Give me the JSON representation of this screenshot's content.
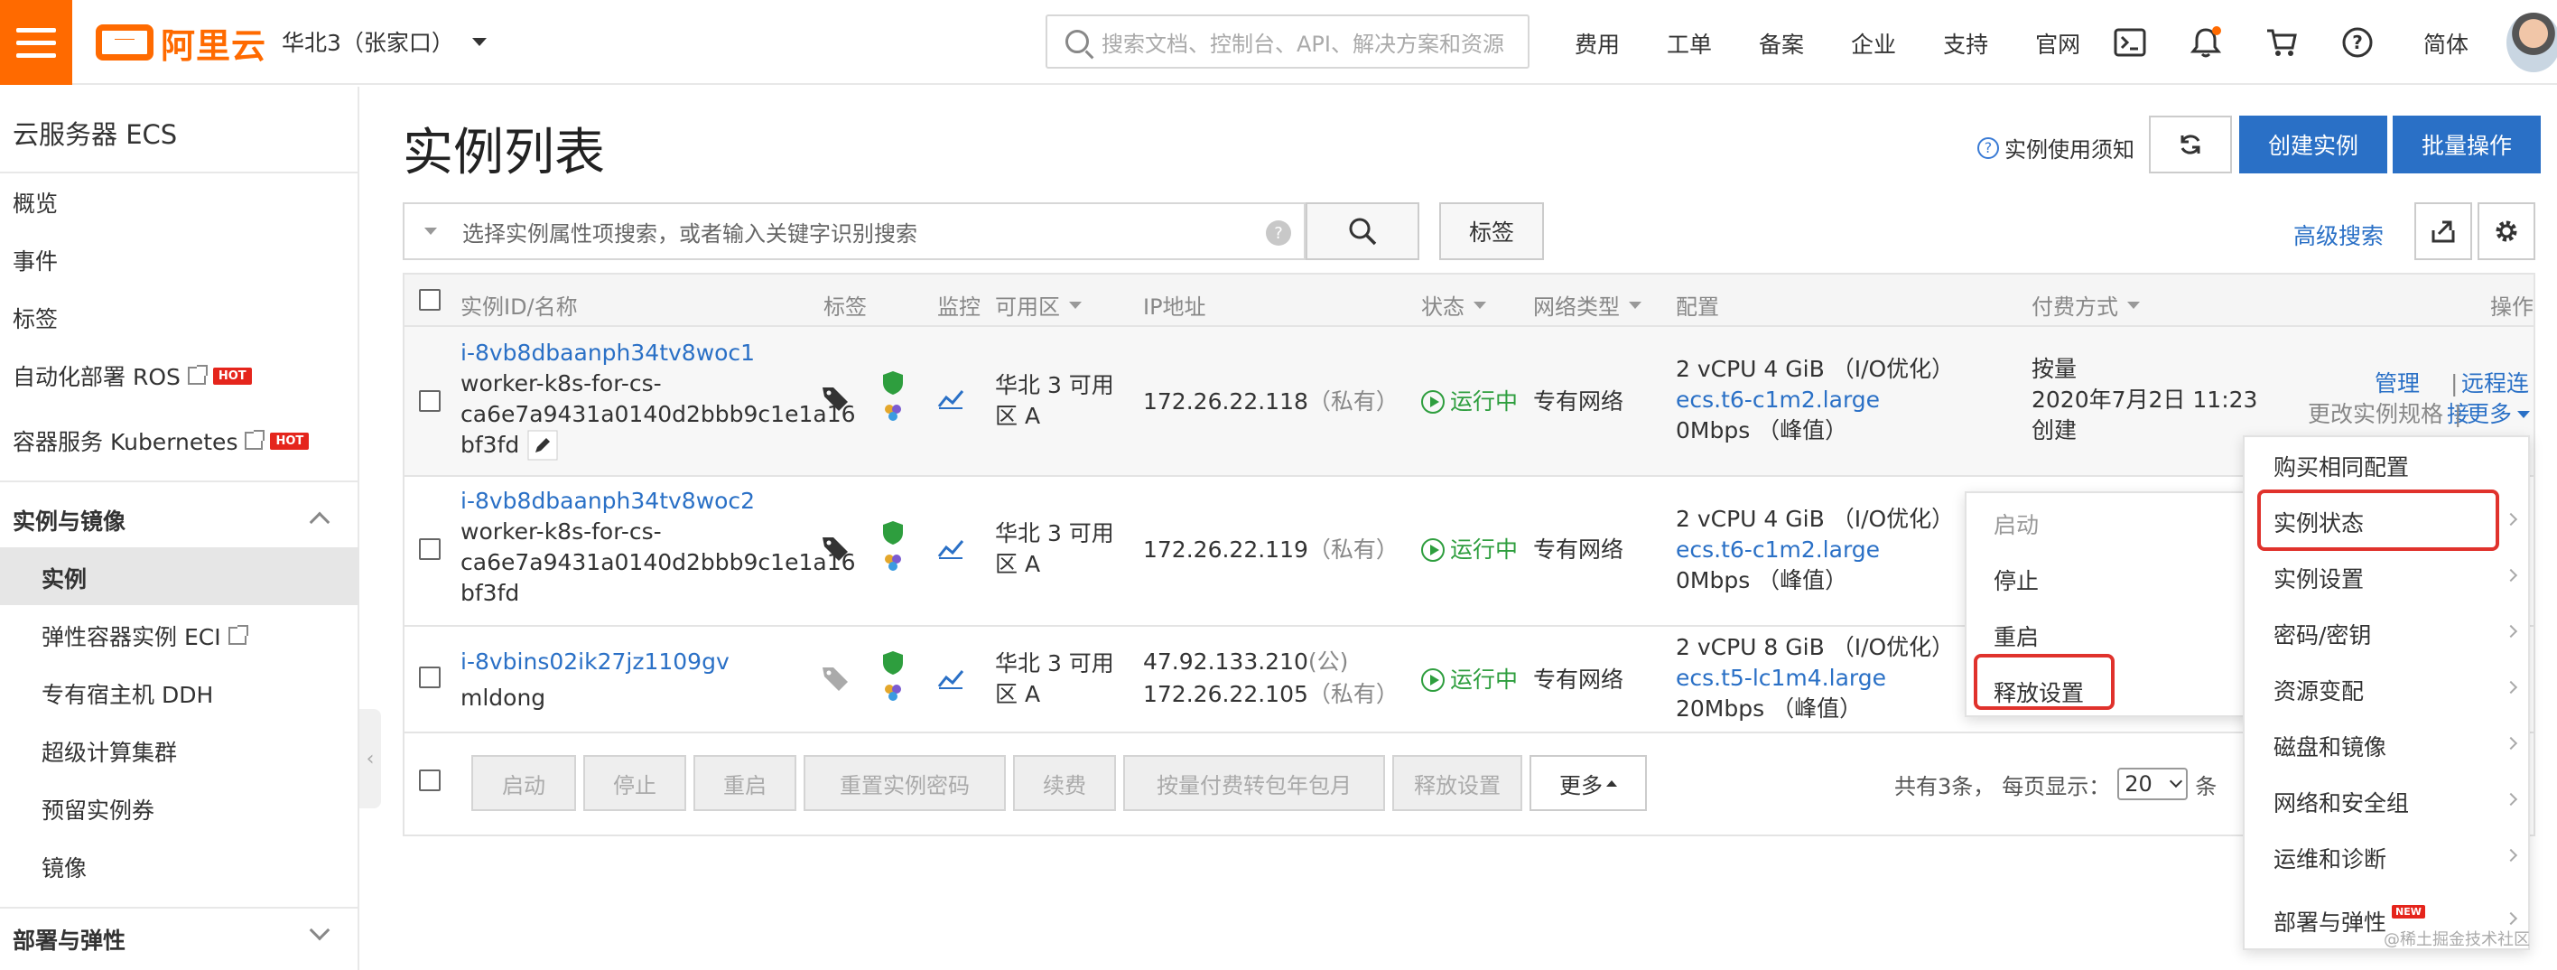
{
  "header": {
    "logo": "阿里云",
    "region": "华北3（张家口）",
    "search_placeholder": "搜索文档、控制台、API、解决方案和资源",
    "links": [
      "费用",
      "工单",
      "备案",
      "企业",
      "支持",
      "官网"
    ],
    "lang": "简体"
  },
  "sidebar": {
    "title": "云服务器 ECS",
    "items": [
      "概览",
      "事件",
      "标签",
      "自动化部署 ROS",
      "容器服务 Kubernetes"
    ],
    "hot": "HOT",
    "group1": "实例与镜像",
    "sub": [
      "实例",
      "弹性容器实例 ECI",
      "专有宿主机 DDH",
      "超级计算集群",
      "预留实例券",
      "镜像"
    ],
    "group2": "部署与弹性"
  },
  "main": {
    "title": "实例列表",
    "notice": "实例使用须知",
    "create": "创建实例",
    "batch": "批量操作",
    "filter_placeholder": "选择实例属性项搜索，或者输入关键字识别搜索",
    "tag_btn": "标签",
    "advanced": "高级搜索"
  },
  "table": {
    "headers": {
      "id": "实例ID/名称",
      "tag": "标签",
      "monitor": "监控",
      "zone": "可用区",
      "ip": "IP地址",
      "status": "状态",
      "net": "网络类型",
      "config": "配置",
      "pay": "付费方式",
      "ops": "操作"
    },
    "rows": [
      {
        "id": "i-8vb8dbaanph34tv8woc1",
        "name1": "worker-k8s-for-cs-",
        "name2": "ca6e7a9431a0140d2bbb9c1e1a16",
        "name3": "bf3fd",
        "zone1": "华北 3 可用",
        "zone2": "区 A",
        "ip1": "172.26.22.118",
        "ip1_note": "（私有）",
        "status": "运行中",
        "net": "专有网络",
        "cfg1": "2 vCPU 4 GiB （I/O优化）",
        "cfg2": "ecs.t6-c1m2.large",
        "cfg3": "0Mbps （峰值）",
        "pay1": "按量",
        "pay2": "2020年7月2日 11:23",
        "pay3": "创建",
        "op_manage": "管理",
        "op_remote": "远程连接",
        "op_change": "更改实例规格",
        "op_more": "更多"
      },
      {
        "id": "i-8vb8dbaanph34tv8woc2",
        "name1": "worker-k8s-for-cs-",
        "name2": "ca6e7a9431a0140d2bbb9c1e1a16",
        "name3": "bf3fd",
        "zone1": "华北 3 可用",
        "zone2": "区 A",
        "ip1": "172.26.22.119",
        "ip1_note": "（私有）",
        "status": "运行中",
        "net": "专有网络",
        "cfg1": "2 vCPU 4 GiB （I/O优化）",
        "cfg2": "ecs.t6-c1m2.large",
        "cfg3": "0Mbps （峰值）"
      },
      {
        "id": "i-8vbins02ik27jz1109gv",
        "name1": "mldong",
        "zone1": "华北 3 可用",
        "zone2": "区 A",
        "ip1": "47.92.133.210",
        "ip1_note": "(公)",
        "ip2": "172.26.22.105",
        "ip2_note": "（私有）",
        "status": "运行中",
        "net": "专有网络",
        "cfg1": "2 vCPU 8 GiB （I/O优化）",
        "cfg2": "ecs.t5-lc1m4.large",
        "cfg3": "20Mbps （峰值）"
      }
    ]
  },
  "footer": {
    "buttons": [
      "启动",
      "停止",
      "重启",
      "重置实例密码",
      "续费",
      "按量付费转包年包月",
      "释放设置"
    ],
    "more": "更多",
    "total": "共有3条，",
    "per_page": "每页显示：",
    "page_size": "20",
    "unit": "条"
  },
  "more_menu": {
    "items": [
      "购买相同配置",
      "实例状态",
      "实例设置",
      "密码/密钥",
      "资源变配",
      "磁盘和镜像",
      "网络和安全组",
      "运维和诊断",
      "部署与弹性"
    ],
    "new": "NEW"
  },
  "status_menu": {
    "items": [
      "启动",
      "停止",
      "重启",
      "释放设置"
    ]
  },
  "watermark": "@稀土掘金技术社区",
  "colors": {
    "brand": "#ff6a00",
    "primary": "#2a70c6",
    "highlight": "#e0322c",
    "running": "#2e9e3e"
  }
}
